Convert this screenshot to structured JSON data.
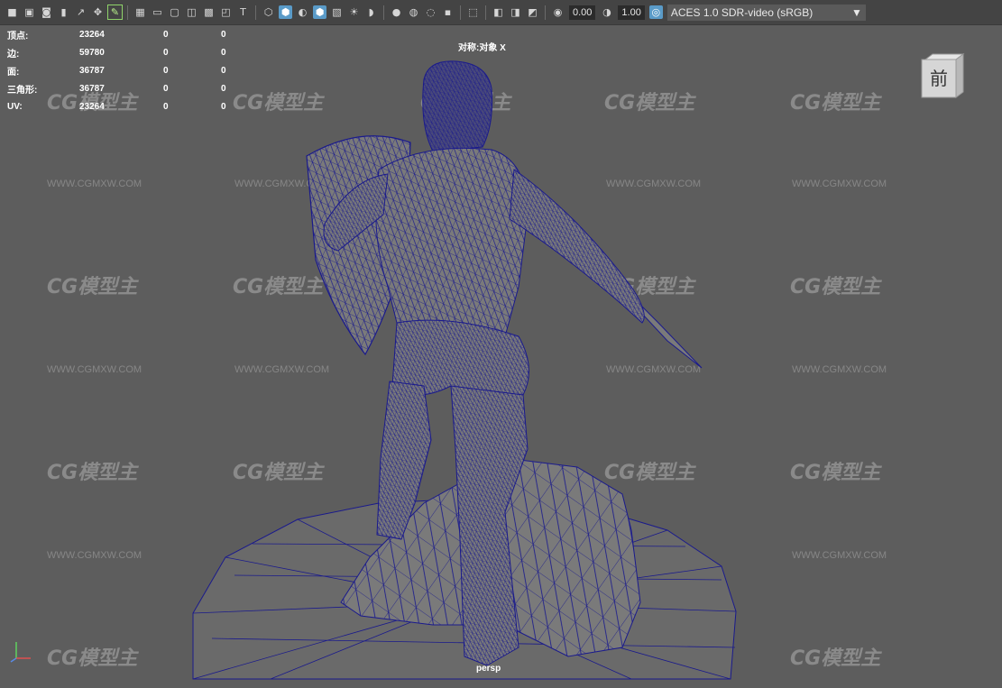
{
  "toolbar": {
    "left_icons": [
      "camera-icon",
      "camera-attr-icon",
      "bookmark-icon",
      "image-plane-icon",
      "grid-icon",
      "film-gate-icon",
      "resolution-gate-icon",
      "gate-mask-icon",
      "field-chart-icon",
      "safe-action-icon",
      "safe-title-icon"
    ],
    "shading_icons": [
      "wireframe-icon",
      "smooth-shade-icon",
      "flat-shade-icon",
      "wireframe-on-shaded-icon",
      "textured-icon",
      "lights-icon",
      "shadows-icon",
      "ambient-occlusion-icon",
      "motion-blur-icon",
      "anti-alias-icon",
      "depth-of-field-icon"
    ],
    "exposure_value": "0.00",
    "gamma_value": "1.00",
    "color_space": "ACES 1.0 SDR-video (sRGB)"
  },
  "hud": {
    "rows": [
      {
        "label": "顶点:",
        "v1": "23264",
        "v2": "0",
        "v3": "0"
      },
      {
        "label": "边:",
        "v1": "59780",
        "v2": "0",
        "v3": "0"
      },
      {
        "label": "面:",
        "v1": "36787",
        "v2": "0",
        "v3": "0"
      },
      {
        "label": "三角形:",
        "v1": "36787",
        "v2": "0",
        "v3": "0"
      },
      {
        "label": "UV:",
        "v1": "23264",
        "v2": "0",
        "v3": "0"
      }
    ],
    "symmetry": "对称:对象 X",
    "camera": "persp"
  },
  "viewcube": {
    "face_label": "前"
  },
  "watermark": {
    "text": "CG模型主",
    "url": "WWW.CGMXW.COM"
  },
  "colors": {
    "wire": "#1a1a8c",
    "background": "#5d5d5d",
    "mesh_fill": "#7a7a7a"
  }
}
